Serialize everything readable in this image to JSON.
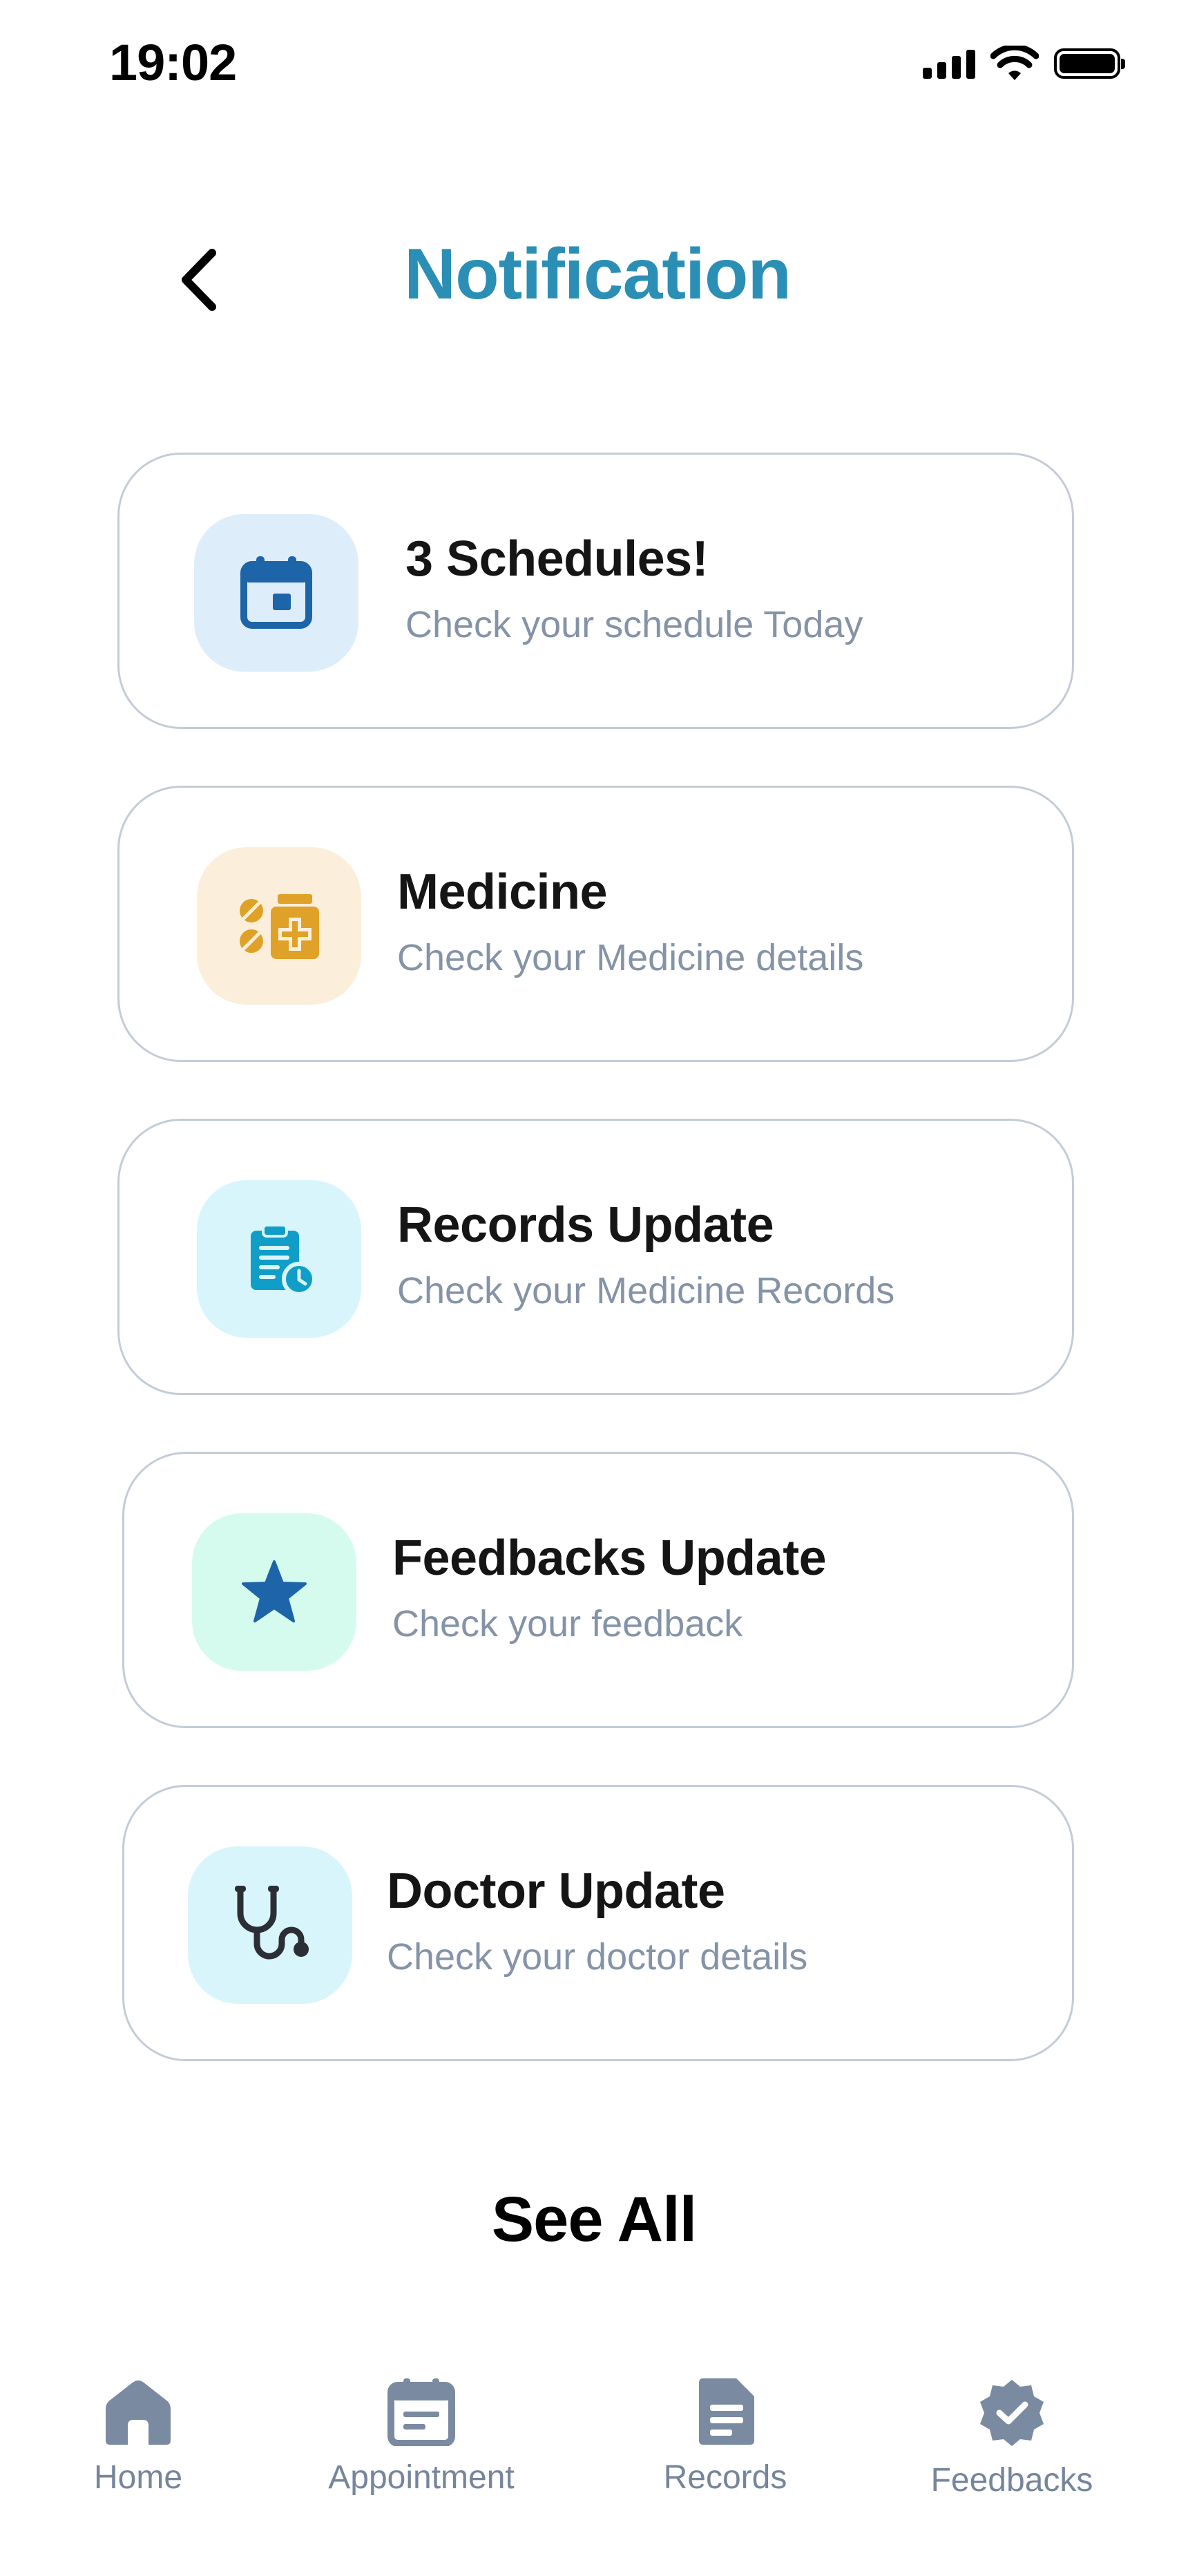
{
  "status_bar": {
    "time": "19:02"
  },
  "header": {
    "title": "Notification",
    "back_icon": "chevron-left-icon"
  },
  "notifications": [
    {
      "title": "3 Schedules!",
      "subtitle": "Check your schedule Today",
      "icon": "calendar-icon",
      "tile_color": "#deedfa",
      "icon_color": "#1e64a8"
    },
    {
      "title": "Medicine",
      "subtitle": "Check your Medicine details",
      "icon": "medicine-icon",
      "tile_color": "#fbefdb",
      "icon_color": "#e0a128"
    },
    {
      "title": "Records Update",
      "subtitle": "Check your Medicine Records",
      "icon": "clipboard-icon",
      "tile_color": "#d9f5fc",
      "icon_color": "#109ec9"
    },
    {
      "title": "Feedbacks Update",
      "subtitle": "Check your feedback",
      "icon": "star-icon",
      "tile_color": "#d5fbef",
      "icon_color": "#1e64a8"
    },
    {
      "title": "Doctor Update",
      "subtitle": "Check your doctor details",
      "icon": "stethoscope-icon",
      "tile_color": "#d9f5fc",
      "icon_color": "#2b2f35"
    }
  ],
  "see_all": "See All",
  "bottom_nav": [
    {
      "label": "Home",
      "icon": "home-icon"
    },
    {
      "label": "Appointment",
      "icon": "calendar-icon"
    },
    {
      "label": "Records",
      "icon": "document-icon"
    },
    {
      "label": "Feedbacks",
      "icon": "verified-badge-icon"
    }
  ],
  "colors": {
    "accent": "#2b8fb5",
    "nav_icon": "#7a8aa0",
    "card_border": "#c3ccd8"
  }
}
